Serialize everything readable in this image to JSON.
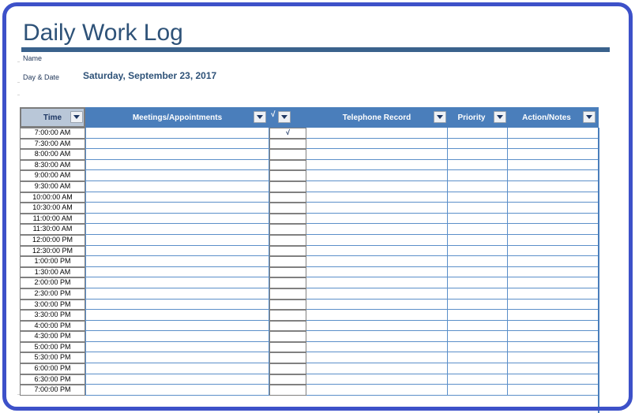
{
  "document": {
    "title": "Daily Work Log",
    "name_label": "Name",
    "name_value": "",
    "day_date_label": "Day & Date",
    "day_date_value": "Saturday, September 23, 2017"
  },
  "theme": {
    "frame_border": "#3d51c9",
    "header_blue": "#4a7ebb",
    "title_text": "#2e5278",
    "rule_blue": "#3a628c",
    "selected_header_fill": "#b9c7d8",
    "grid_grey": "#808080",
    "grid_blue": "#5b8fc9"
  },
  "table": {
    "columns": [
      {
        "key": "time",
        "label": "Time",
        "filter_icon": "chevron-down-icon",
        "selected": true
      },
      {
        "key": "meetings",
        "label": "Meetings/Appointments",
        "filter_icon": "chevron-down-icon",
        "selected": false
      },
      {
        "key": "check",
        "label": "√",
        "filter_icon": "chevron-down-icon",
        "selected": false
      },
      {
        "key": "telephone",
        "label": "Telephone Record",
        "filter_icon": "chevron-down-icon",
        "selected": false
      },
      {
        "key": "priority",
        "label": "Priority",
        "filter_icon": "chevron-down-icon",
        "selected": false
      },
      {
        "key": "action",
        "label": "Action/Notes",
        "filter_icon": "chevron-down-icon",
        "selected": false
      }
    ],
    "rows": [
      {
        "time": "7:00:00 AM",
        "meetings": "",
        "check": "√",
        "telephone": "",
        "priority": "",
        "action": ""
      },
      {
        "time": "7:30:00 AM",
        "meetings": "",
        "check": "",
        "telephone": "",
        "priority": "",
        "action": ""
      },
      {
        "time": "8:00:00 AM",
        "meetings": "",
        "check": "",
        "telephone": "",
        "priority": "",
        "action": ""
      },
      {
        "time": "8:30:00 AM",
        "meetings": "",
        "check": "",
        "telephone": "",
        "priority": "",
        "action": ""
      },
      {
        "time": "9:00:00 AM",
        "meetings": "",
        "check": "",
        "telephone": "",
        "priority": "",
        "action": ""
      },
      {
        "time": "9:30:00 AM",
        "meetings": "",
        "check": "",
        "telephone": "",
        "priority": "",
        "action": ""
      },
      {
        "time": "10:00:00 AM",
        "meetings": "",
        "check": "",
        "telephone": "",
        "priority": "",
        "action": ""
      },
      {
        "time": "10:30:00 AM",
        "meetings": "",
        "check": "",
        "telephone": "",
        "priority": "",
        "action": ""
      },
      {
        "time": "11:00:00 AM",
        "meetings": "",
        "check": "",
        "telephone": "",
        "priority": "",
        "action": ""
      },
      {
        "time": "11:30:00 AM",
        "meetings": "",
        "check": "",
        "telephone": "",
        "priority": "",
        "action": ""
      },
      {
        "time": "12:00:00 PM",
        "meetings": "",
        "check": "",
        "telephone": "",
        "priority": "",
        "action": ""
      },
      {
        "time": "12:30:00 PM",
        "meetings": "",
        "check": "",
        "telephone": "",
        "priority": "",
        "action": ""
      },
      {
        "time": "1:00:00 PM",
        "meetings": "",
        "check": "",
        "telephone": "",
        "priority": "",
        "action": ""
      },
      {
        "time": "1:30:00 AM",
        "meetings": "",
        "check": "",
        "telephone": "",
        "priority": "",
        "action": ""
      },
      {
        "time": "2:00:00 PM",
        "meetings": "",
        "check": "",
        "telephone": "",
        "priority": "",
        "action": ""
      },
      {
        "time": "2:30:00 PM",
        "meetings": "",
        "check": "",
        "telephone": "",
        "priority": "",
        "action": ""
      },
      {
        "time": "3:00:00 PM",
        "meetings": "",
        "check": "",
        "telephone": "",
        "priority": "",
        "action": ""
      },
      {
        "time": "3:30:00 PM",
        "meetings": "",
        "check": "",
        "telephone": "",
        "priority": "",
        "action": ""
      },
      {
        "time": "4:00:00 PM",
        "meetings": "",
        "check": "",
        "telephone": "",
        "priority": "",
        "action": ""
      },
      {
        "time": "4:30:00 PM",
        "meetings": "",
        "check": "",
        "telephone": "",
        "priority": "",
        "action": ""
      },
      {
        "time": "5:00:00 PM",
        "meetings": "",
        "check": "",
        "telephone": "",
        "priority": "",
        "action": ""
      },
      {
        "time": "5:30:00 PM",
        "meetings": "",
        "check": "",
        "telephone": "",
        "priority": "",
        "action": ""
      },
      {
        "time": "6:00:00 PM",
        "meetings": "",
        "check": "",
        "telephone": "",
        "priority": "",
        "action": ""
      },
      {
        "time": "6:30:00 PM",
        "meetings": "",
        "check": "",
        "telephone": "",
        "priority": "",
        "action": ""
      },
      {
        "time": "7:00:00 PM",
        "meetings": "",
        "check": "",
        "telephone": "",
        "priority": "",
        "action": ""
      }
    ]
  }
}
